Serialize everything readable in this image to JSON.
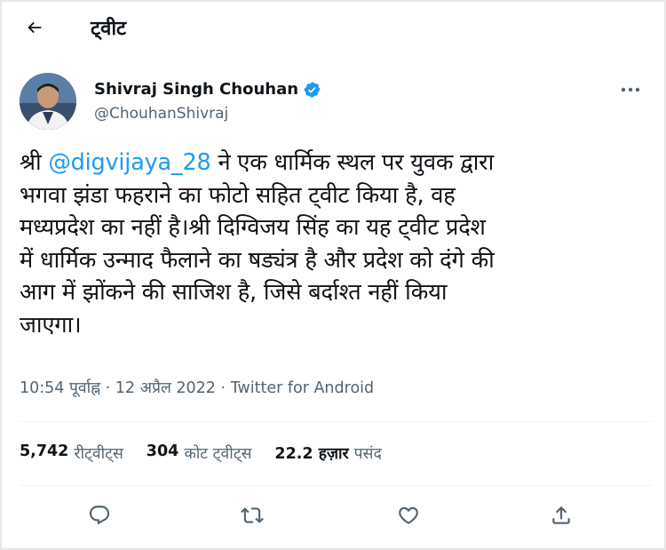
{
  "header": {
    "title": "ट्वीट"
  },
  "author": {
    "name": "Shivraj Singh Chouhan",
    "handle": "@ChouhanShivraj"
  },
  "tweet": {
    "prefix": "श्री ",
    "mention": "@digvijaya_28",
    "body": " ने एक धार्मिक स्थल पर युवक द्वारा\nभगवा झंडा फहराने का फोटो सहित ट्वीट किया है, वह\nमध्यप्रदेश का नहीं है।श्री दिग्विजय सिंह का यह ट्वीट प्रदेश\nमें धार्मिक उन्माद फैलाने का षड्यंत्र है और प्रदेश को दंगे की\nआग में झोंकने की साजिश है, जिसे बर्दाश्त नहीं किया\nजाएगा।"
  },
  "meta": {
    "time": "10:54 पूर्वाह्न",
    "sep1": " · ",
    "date": "12 अप्रैल 2022",
    "sep2": " · ",
    "source": "Twitter for Android"
  },
  "stats": {
    "retweets_count": "5,742",
    "retweets_label": "रीट्वीट्स",
    "quotes_count": "304",
    "quotes_label": "कोट ट्वीट्स",
    "likes_count": "22.2 हज़ार",
    "likes_label": "पसंद"
  },
  "colors": {
    "accent": "#1d9bf0",
    "text": "#0f1419",
    "muted": "#536471"
  },
  "icons": [
    "back-arrow-icon",
    "verified-badge-icon",
    "more-icon",
    "reply-icon",
    "retweet-icon",
    "like-icon",
    "share-icon"
  ]
}
